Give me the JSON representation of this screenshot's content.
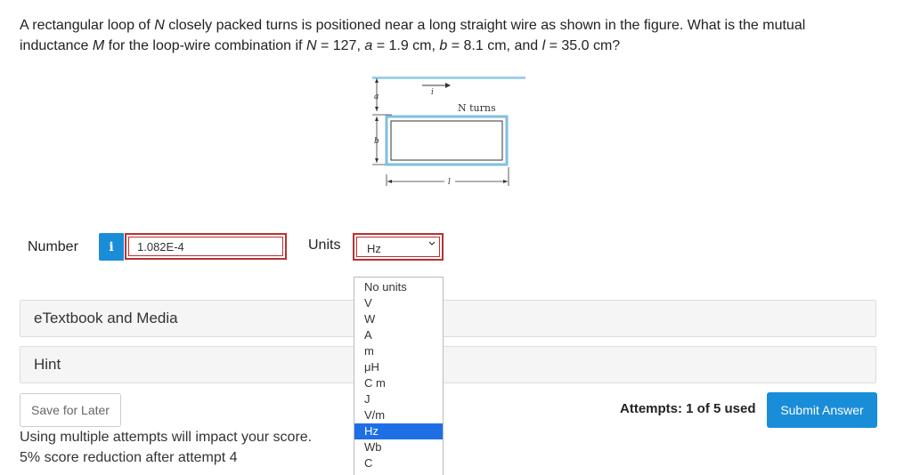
{
  "question": {
    "p1": "A rectangular loop of ",
    "N": "N",
    "p2": " closely packed turns is positioned near a long straight wire as shown in the figure. What is the mutual inductance ",
    "M": "M",
    "p3": " for the loop-wire combination if ",
    "N2": "N",
    "p4": " = 127, ",
    "a": "a",
    "p5": " = 1.9 cm, ",
    "b": "b",
    "p6": " = 8.1 cm, and ",
    "l": "l",
    "p7": " = 35.0 cm?"
  },
  "figure": {
    "label_a": "a",
    "label_b": "b",
    "label_i": "i",
    "label_l": "l",
    "label_turns": "N turns"
  },
  "answer": {
    "number_label": "Number",
    "info_icon": "i",
    "value": "1.082E-4",
    "units_label": "Units",
    "units_value": "Hz"
  },
  "units_options": [
    "No units",
    "V",
    "W",
    "A",
    "m",
    "μH",
    "C m",
    "J",
    "V/m",
    "Hz",
    "Wb",
    "C"
  ],
  "units_selected_index": 9,
  "panels": {
    "etextbook": "eTextbook and Media",
    "hint": "Hint"
  },
  "footer": {
    "save_label": "Save for Later",
    "note_line1": "Using multiple attempts will impact your score.",
    "note_line2": "5% score reduction after attempt 4",
    "attempts": "Attempts: 1 of 5 used",
    "submit_label": "Submit Answer"
  },
  "colors": {
    "accent": "#1a8dd9",
    "error_border": "#b83232",
    "selected_option": "#1e6fe6",
    "panel_bg": "#f5f5f5"
  }
}
